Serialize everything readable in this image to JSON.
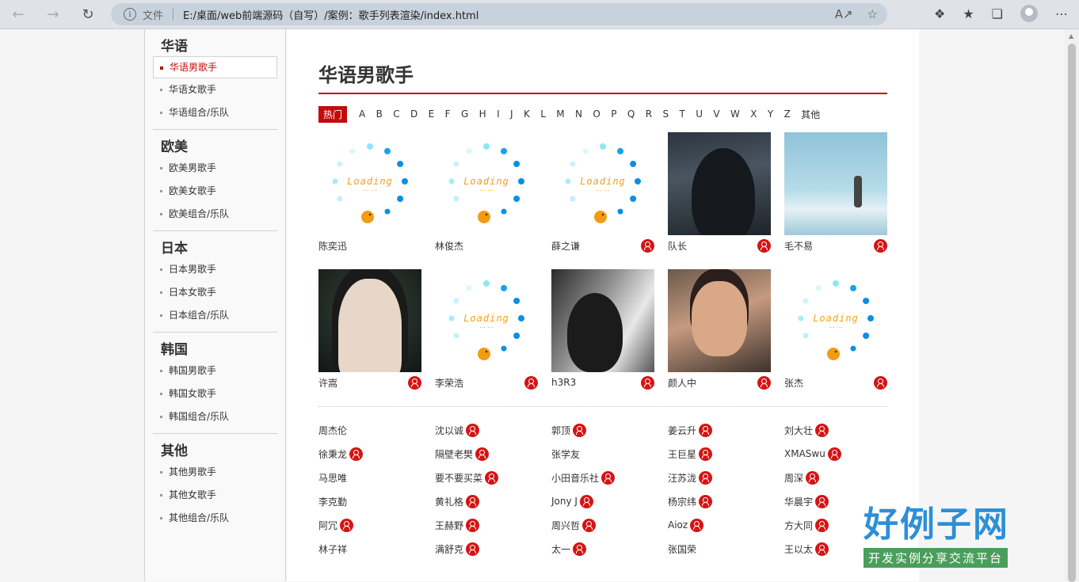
{
  "browser": {
    "scheme_label": "文件",
    "url": "E:/桌面/web前端源码（自写）/案例：歌手列表渲染/index.html"
  },
  "sidebar": [
    {
      "title": "华语",
      "items": [
        "华语男歌手",
        "华语女歌手",
        "华语组合/乐队"
      ]
    },
    {
      "title": "欧美",
      "items": [
        "欧美男歌手",
        "欧美女歌手",
        "欧美组合/乐队"
      ]
    },
    {
      "title": "日本",
      "items": [
        "日本男歌手",
        "日本女歌手",
        "日本组合/乐队"
      ]
    },
    {
      "title": "韩国",
      "items": [
        "韩国男歌手",
        "韩国女歌手",
        "韩国组合/乐队"
      ]
    },
    {
      "title": "其他",
      "items": [
        "其他男歌手",
        "其他女歌手",
        "其他组合/乐队"
      ]
    }
  ],
  "main": {
    "title": "华语男歌手",
    "hot_label": "热门",
    "letters": [
      "A",
      "B",
      "C",
      "D",
      "E",
      "F",
      "G",
      "H",
      "I",
      "J",
      "K",
      "L",
      "M",
      "N",
      "O",
      "P",
      "Q",
      "R",
      "S",
      "T",
      "U",
      "V",
      "W",
      "X",
      "Y",
      "Z"
    ],
    "other_label": "其他",
    "loading_text": "Loading",
    "cards": [
      {
        "name": "陈奕迅",
        "image": "loading",
        "has_icon": false
      },
      {
        "name": "林俊杰",
        "image": "loading",
        "has_icon": false
      },
      {
        "name": "薛之谦",
        "image": "loading",
        "has_icon": true
      },
      {
        "name": "队长",
        "image": "photo-dark",
        "has_icon": true
      },
      {
        "name": "毛不易",
        "image": "photo-sky",
        "has_icon": true
      },
      {
        "name": "许嵩",
        "image": "photo-studio",
        "has_icon": true
      },
      {
        "name": "李荣浩",
        "image": "loading",
        "has_icon": true
      },
      {
        "name": "h3R3",
        "image": "photo-bw",
        "has_icon": true
      },
      {
        "name": "颜人中",
        "image": "photo-warm",
        "has_icon": true
      },
      {
        "name": "张杰",
        "image": "loading",
        "has_icon": true
      }
    ],
    "names": [
      {
        "name": "周杰伦",
        "icon": false
      },
      {
        "name": "沈以诚",
        "icon": true
      },
      {
        "name": "郭顶",
        "icon": true
      },
      {
        "name": "姜云升",
        "icon": true
      },
      {
        "name": "刘大壮",
        "icon": true
      },
      {
        "name": "徐秉龙",
        "icon": true
      },
      {
        "name": "隔壁老樊",
        "icon": true
      },
      {
        "name": "张学友",
        "icon": false
      },
      {
        "name": "王巨星",
        "icon": true
      },
      {
        "name": "XMASwu",
        "icon": true
      },
      {
        "name": "马思唯",
        "icon": false
      },
      {
        "name": "要不要买菜",
        "icon": true
      },
      {
        "name": "小田音乐社",
        "icon": true
      },
      {
        "name": "汪苏泷",
        "icon": true
      },
      {
        "name": "周深",
        "icon": true
      },
      {
        "name": "李克勤",
        "icon": false
      },
      {
        "name": "黄礼格",
        "icon": true
      },
      {
        "name": "Jony J",
        "icon": true
      },
      {
        "name": "杨宗纬",
        "icon": true
      },
      {
        "name": "华晨宇",
        "icon": true
      },
      {
        "name": "阿冗",
        "icon": true
      },
      {
        "name": "王赫野",
        "icon": true
      },
      {
        "name": "周兴哲",
        "icon": true
      },
      {
        "name": "Aioz",
        "icon": true
      },
      {
        "name": "方大同",
        "icon": true
      },
      {
        "name": "林子祥",
        "icon": false
      },
      {
        "name": "满舒克",
        "icon": true
      },
      {
        "name": "太一",
        "icon": true
      },
      {
        "name": "张国荣",
        "icon": false
      },
      {
        "name": "王以太",
        "icon": true
      }
    ]
  },
  "watermark": {
    "big": "好例子网",
    "small": "开发实例分享交流平台"
  },
  "colors": {
    "accent": "#c20c0c",
    "loading_blue": "#0a8fe6",
    "loading_orange": "#f39c12"
  }
}
